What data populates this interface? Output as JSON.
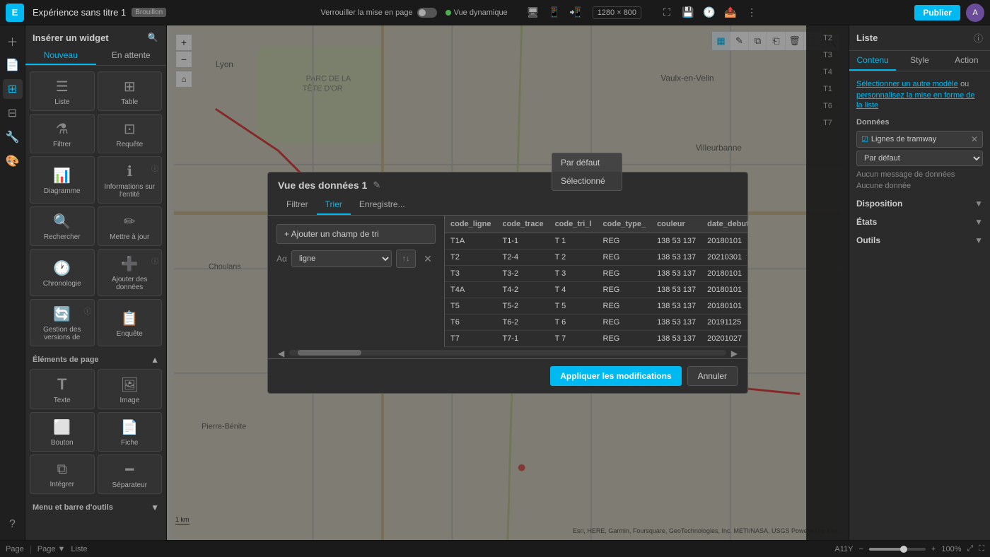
{
  "topbar": {
    "logo": "E",
    "title": "Expérience sans titre 1",
    "badge": "Brouillon",
    "lock_label": "Verrouiller la mise en page",
    "view_label": "Vue dynamique",
    "resolution": "1280 × 800",
    "publish_label": "Publier",
    "avatar": "A"
  },
  "widget_panel": {
    "title": "Insérer un widget",
    "tab_new": "Nouveau",
    "tab_pending": "En attente",
    "widgets": [
      {
        "id": "liste",
        "label": "Liste",
        "icon": "☰"
      },
      {
        "id": "table",
        "label": "Table",
        "icon": "⊞"
      },
      {
        "id": "filtrer",
        "label": "Filtrer",
        "icon": "⚗"
      },
      {
        "id": "requete",
        "label": "Requête",
        "icon": "⊡"
      },
      {
        "id": "diagramme",
        "label": "Diagramme",
        "icon": "📊"
      },
      {
        "id": "info-entite",
        "label": "Informations sur l'entité",
        "icon": "ℹ"
      },
      {
        "id": "rechercher",
        "label": "Rechercher",
        "icon": "🔍"
      },
      {
        "id": "mettre-a-jour",
        "label": "Mettre à jour",
        "icon": "✏"
      },
      {
        "id": "chronologie",
        "label": "Chronologie",
        "icon": "🕐"
      },
      {
        "id": "ajouter-donnees",
        "label": "Ajouter des données",
        "icon": "➕"
      },
      {
        "id": "gestion-versions",
        "label": "Gestion des versions de",
        "icon": "🔄"
      },
      {
        "id": "enquete",
        "label": "Enquête",
        "icon": "📋"
      }
    ],
    "section_page": "Éléments de page",
    "page_widgets": [
      {
        "id": "texte",
        "label": "Texte",
        "icon": "T"
      },
      {
        "id": "image",
        "label": "Image",
        "icon": "🖼"
      },
      {
        "id": "bouton",
        "label": "Bouton",
        "icon": "⬜"
      },
      {
        "id": "fiche",
        "label": "Fiche",
        "icon": "📄"
      },
      {
        "id": "integrer",
        "label": "Intégrer",
        "icon": "⧉"
      },
      {
        "id": "separateur",
        "label": "Séparateur",
        "icon": "━"
      }
    ],
    "section_menu": "Menu et barre d'outils"
  },
  "map": {
    "zoom_in": "+",
    "zoom_out": "−",
    "home": "⌂",
    "search": "🔍",
    "scale": "1 km",
    "attribution": "Esri, HERE, Garmin, Foursquare, GeoTechnologies, Inc. METI/NASA, USGS  Powered by Esri..."
  },
  "list_panel": {
    "items": [
      "T2",
      "T3",
      "T4",
      "T1",
      "T6",
      "T7"
    ]
  },
  "modal": {
    "title": "Vue des données 1",
    "tabs": [
      "Filtrer",
      "Trier",
      "Enregistre..."
    ],
    "active_tab": "Trier",
    "add_sort_btn": "+ Ajouter un champ de tri",
    "sort_field_value": "ligne",
    "sort_dropdown_items": [
      "Par défaut",
      "Sélectionné"
    ],
    "table": {
      "columns": [
        "code_ligne",
        "code_trace",
        "code_tri_l",
        "code_type_",
        "couleur",
        "date_debut"
      ],
      "rows": [
        [
          "T1A",
          "T1-1",
          "T 1",
          "REG",
          "138 53 137",
          "20180101"
        ],
        [
          "T2",
          "T2-4",
          "T 2",
          "REG",
          "138 53 137",
          "20210301"
        ],
        [
          "T3",
          "T3-2",
          "T 3",
          "REG",
          "138 53 137",
          "20180101"
        ],
        [
          "T4A",
          "T4-2",
          "T 4",
          "REG",
          "138 53 137",
          "20180101"
        ],
        [
          "T5",
          "T5-2",
          "T 5",
          "REG",
          "138 53 137",
          "20180101"
        ],
        [
          "T6",
          "T6-2",
          "T 6",
          "REG",
          "138 53 137",
          "20191125"
        ],
        [
          "T7",
          "T7-1",
          "T 7",
          "REG",
          "138 53 137",
          "20201027"
        ]
      ]
    },
    "apply_btn": "Appliquer les modifications",
    "cancel_btn": "Annuler"
  },
  "right_panel": {
    "title": "Liste",
    "tabs": [
      "Contenu",
      "Style",
      "Action"
    ],
    "active_tab": "Contenu",
    "select_model_text": "Sélectionner un autre modèle",
    "or_text": "ou",
    "customize_text": "personnalisez la mise en forme de la liste",
    "section_data": "Données",
    "data_layer": "Lignes de tramway",
    "default_select": "Par défaut",
    "no_data_message": "Aucun message de données",
    "no_data_value": "Aucune donnée",
    "section_disposition": "Disposition",
    "section_etats": "États",
    "section_outils": "Outils"
  },
  "statusbar": {
    "page": "Page",
    "page_dropdown": "Page",
    "list": "Liste",
    "position": "A11Y",
    "zoom": "100%"
  }
}
